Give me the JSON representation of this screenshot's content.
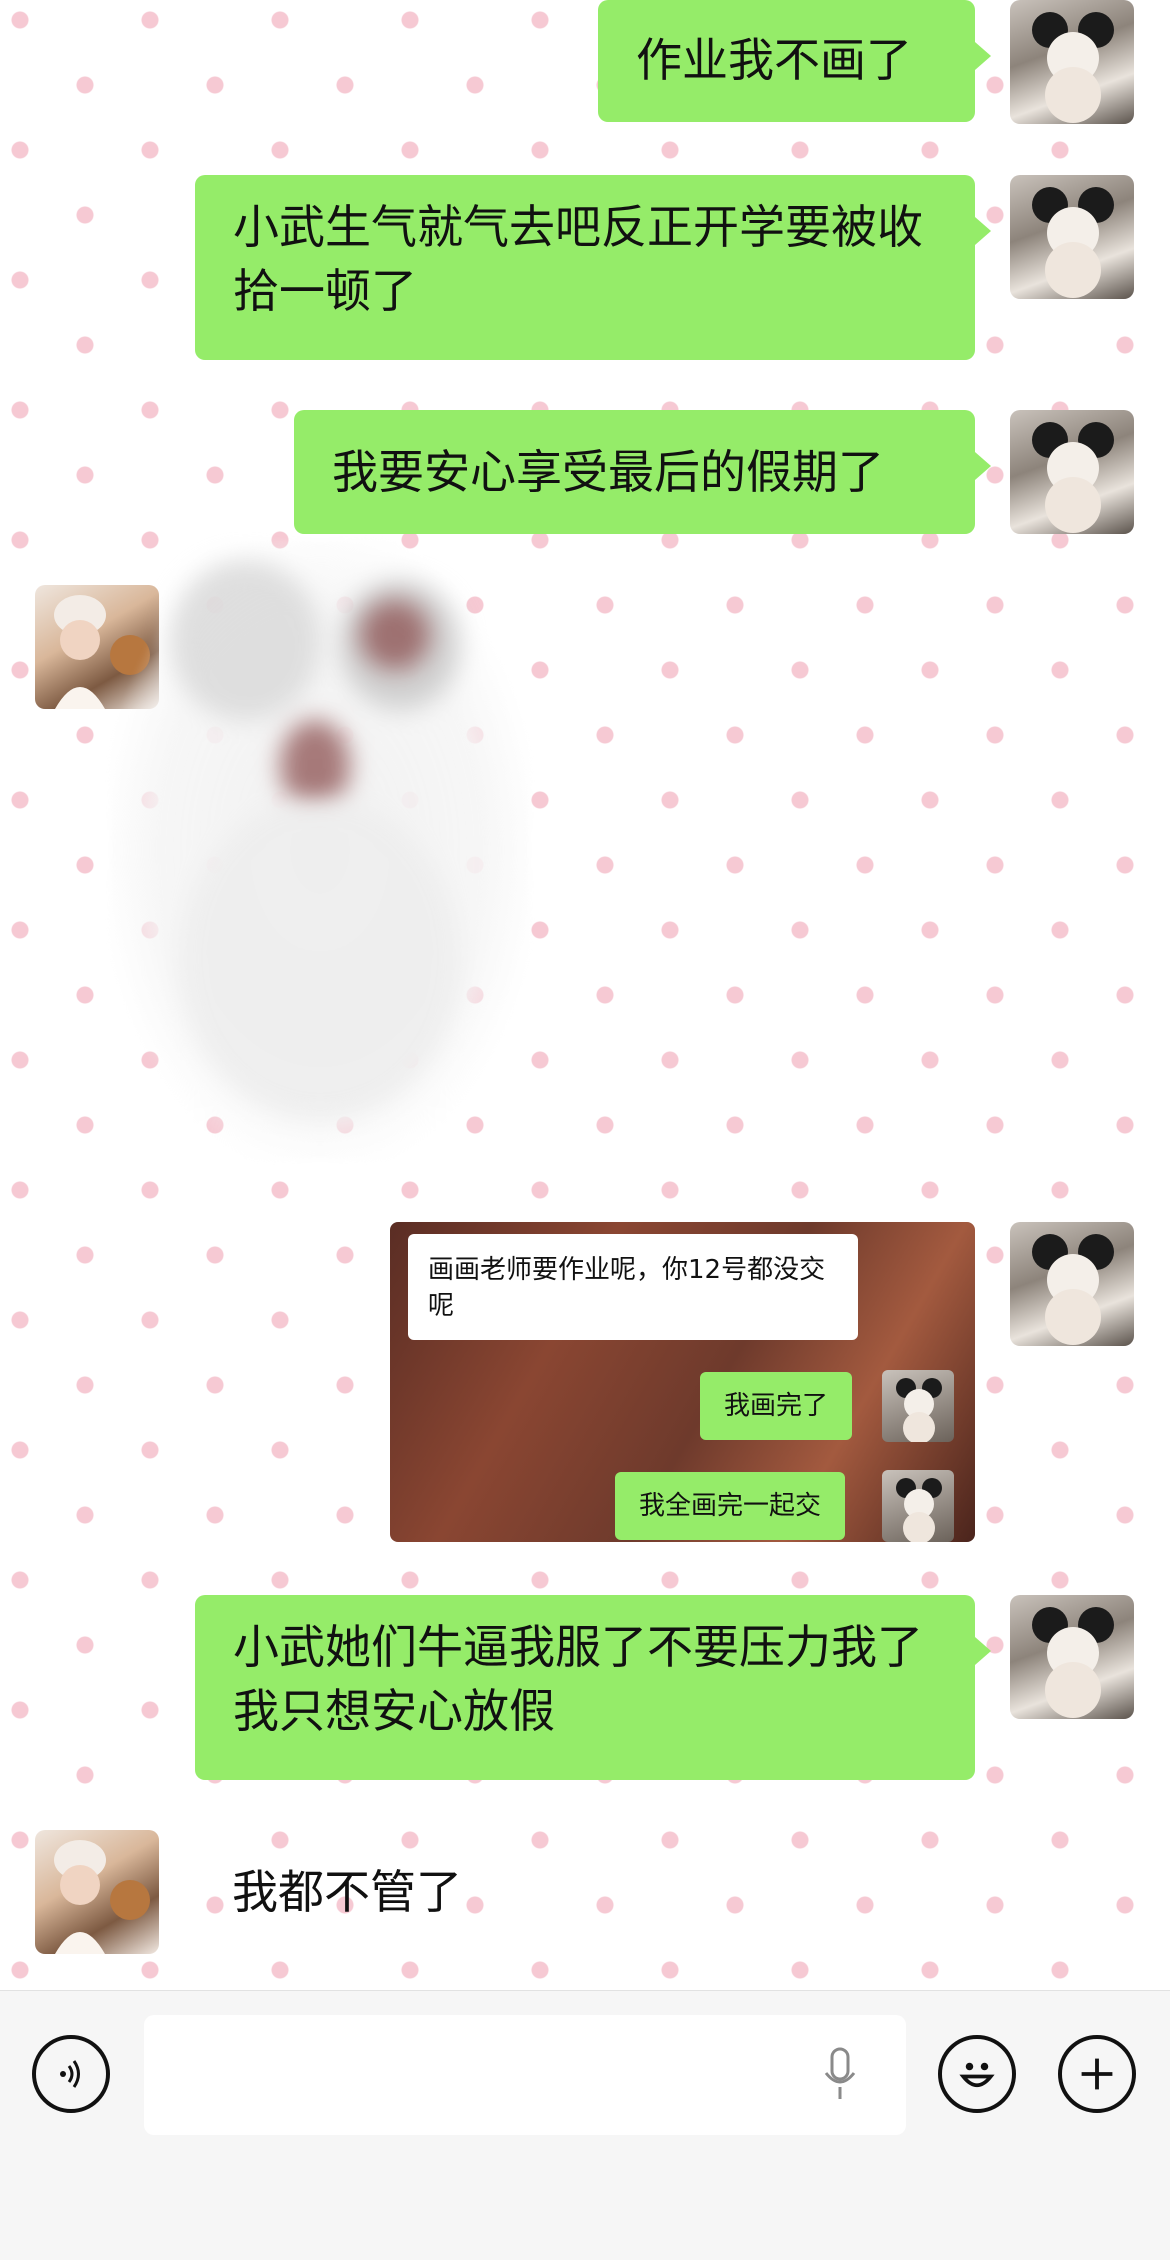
{
  "messages": [
    {
      "side": "right",
      "type": "text",
      "text": "作业我不画了"
    },
    {
      "side": "right",
      "type": "text",
      "text": "小武生气就气去吧反正开学要被收拾一顿了"
    },
    {
      "side": "right",
      "type": "text",
      "text": "我要安心享受最后的假期了"
    },
    {
      "side": "left",
      "type": "image"
    },
    {
      "side": "right",
      "type": "screenshot",
      "screenshot": {
        "incoming": "画画老师要作业呢，你12号都没交呢",
        "reply_1": "我画完了",
        "reply_2": "我全画完一起交"
      }
    },
    {
      "side": "right",
      "type": "text",
      "text": "小武她们牛逼我服了不要压力我了我只想安心放假"
    },
    {
      "side": "left",
      "type": "text",
      "text": "我都不管了"
    }
  ],
  "colors": {
    "bubble_green": "#95ec69",
    "dot_pink": "#f6c9d3",
    "input_bar": "#f6f6f6"
  },
  "input_bar": {
    "voice_icon": "voice-icon",
    "mic_icon": "microphone-icon",
    "emoji_icon": "emoji-icon",
    "plus_icon": "plus-icon"
  }
}
